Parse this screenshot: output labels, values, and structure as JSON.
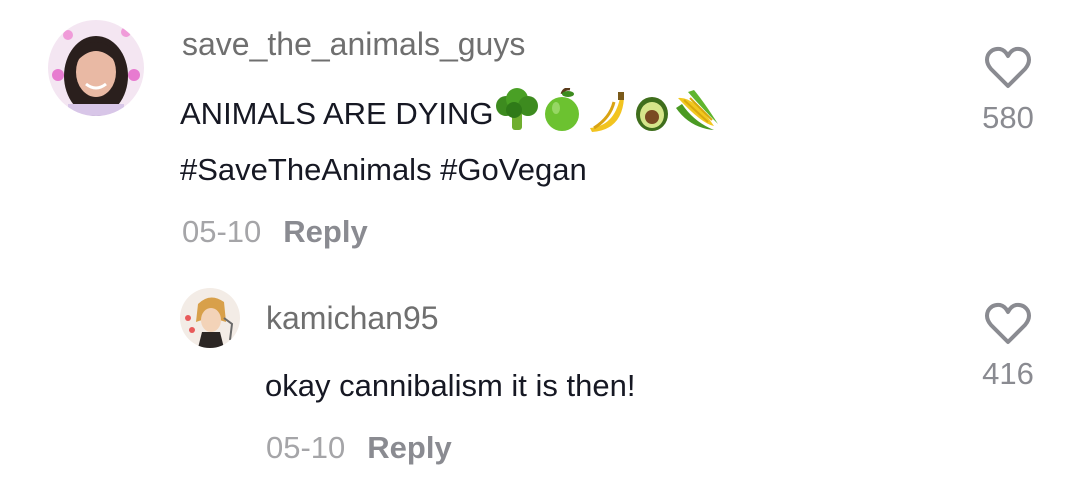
{
  "comments": [
    {
      "username": "save_the_animals_guys",
      "text_line1": "ANIMALS ARE DYING",
      "emojis": [
        "broccoli-icon",
        "green-apple-icon",
        "banana-icon",
        "avocado-icon",
        "corn-icon"
      ],
      "text_line2": "#SaveTheAnimals #GoVegan",
      "date": "05-10",
      "reply_label": "Reply",
      "likes": "580"
    },
    {
      "username": "kamichan95",
      "text_line1": "okay cannibalism it is then!",
      "date": "05-10",
      "reply_label": "Reply",
      "likes": "416"
    }
  ],
  "colors": {
    "username": "#6f6f6f",
    "text": "#161823",
    "meta": "#a5a5a8",
    "heart": "#8a8b91"
  }
}
